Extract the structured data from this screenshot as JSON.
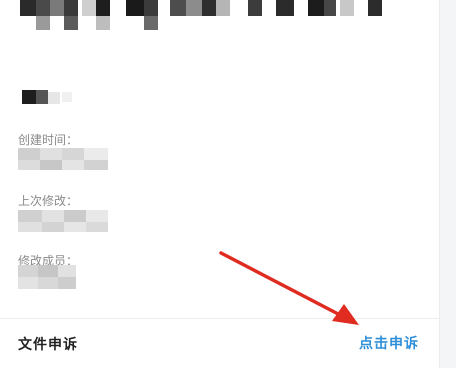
{
  "file_info": {
    "created_label": "创建时间：",
    "modified_label": "上次修改：",
    "modifier_label": "修改成员："
  },
  "appeal": {
    "section_title": "文件申诉",
    "action_label": "点击申诉"
  },
  "colors": {
    "accent": "#2f8fd8",
    "arrow": "#e02b20"
  },
  "icons": [
    "red-arrow-annotation"
  ]
}
